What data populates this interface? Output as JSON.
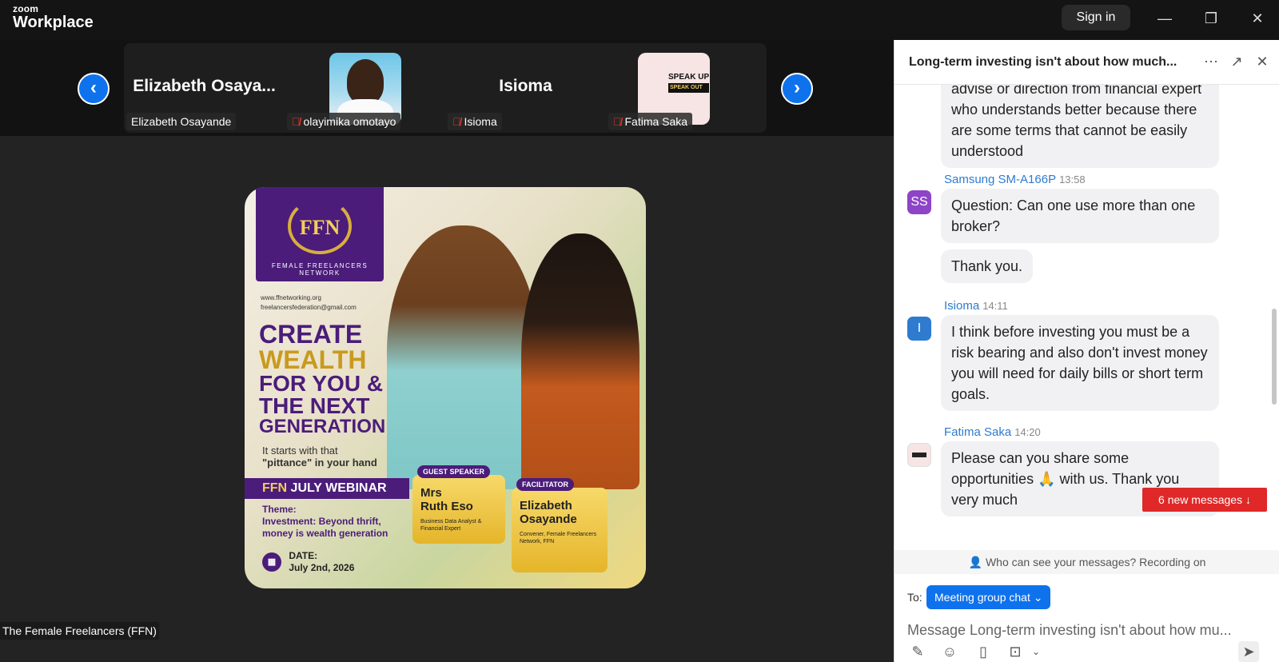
{
  "app": {
    "brand_top": "zoom",
    "brand_bottom": "Workplace",
    "sign_in": "Sign in"
  },
  "window_controls": {
    "minimize": "—",
    "restore": "❐",
    "close": "✕"
  },
  "strip": {
    "prev": "‹",
    "next": "›",
    "tiles": [
      {
        "big_name": "Elizabeth  Osaya...",
        "label": "Elizabeth Osayande",
        "muted": false
      },
      {
        "big_name": "",
        "label": "olayimika omotayo",
        "muted": true
      },
      {
        "big_name": "Isioma",
        "label": "Isioma",
        "muted": true
      },
      {
        "big_name": "",
        "label": "Fatima Saka",
        "muted": true
      }
    ],
    "fatima_thumb": {
      "l1": "SPEAK UP",
      "l2": "SPEAK OUT"
    }
  },
  "poster": {
    "ffn": "FFN",
    "network": "FEMALE FREELANCERS NETWORK",
    "web": "www.ffnetworking.org",
    "email": "freelancersfederation@gmail.com",
    "h1": "CREATE",
    "h2": "WEALTH",
    "h3a": "FOR YOU &",
    "h3b": "THE NEXT",
    "h4": "GENERATION",
    "starts1": "It starts with that",
    "starts2": "\"pittance\" in your hand",
    "webinar_a": "FFN ",
    "webinar_b": "JULY WEBINAR",
    "theme_label": "Theme:",
    "theme": "Investment: Beyond thrift, money is wealth generation",
    "date_label": "DATE:",
    "date": "July 2nd, 2026",
    "guest_tag": "GUEST SPEAKER",
    "guest_title": "Mrs",
    "guest_name": "Ruth Eso",
    "guest_desc": "Business Data Analyst & Financial Expert",
    "fac_tag": "FACILITATOR",
    "fac_name1": "Elizabeth",
    "fac_name2": "Osayande",
    "fac_desc": "Convener, Female Freelancers Network, FFN"
  },
  "presenter_label": "The Female Freelancers (FFN)",
  "chat": {
    "title": "Long-term investing isn't about how much...",
    "messages": [
      {
        "text": "advise or direction from financial expert who understands better because there are some terms that cannot be easily understood"
      },
      {
        "sender": "Samsung SM-A166P",
        "time": "13:58",
        "avatar": "SS",
        "avatar_color": "#8e44c6",
        "text": "Question: Can one use more than one broker?"
      },
      {
        "text": "Thank you."
      },
      {
        "sender": "Isioma",
        "time": "14:11",
        "avatar": "I",
        "avatar_color": "#2e7bd0",
        "text": "I think before investing you must be a risk bearing and also don't invest money you will need for daily bills or short term goals."
      },
      {
        "sender": "Fatima Saka",
        "time": "14:20",
        "text": "Please can you share some opportunities 🙏 with us. Thank you very much"
      }
    ],
    "new_messages": "6 new messages ↓",
    "who_can_see": "Who can see your messages? Recording on",
    "to_label": "To:",
    "to_value": "Meeting group chat ⌄",
    "input_placeholder": "Message Long-term investing isn't about how mu..."
  },
  "colors": {
    "accent": "#0e72ed",
    "alert": "#e02828",
    "poster_purple": "#4b1c7a",
    "poster_gold": "#c99a1d"
  }
}
